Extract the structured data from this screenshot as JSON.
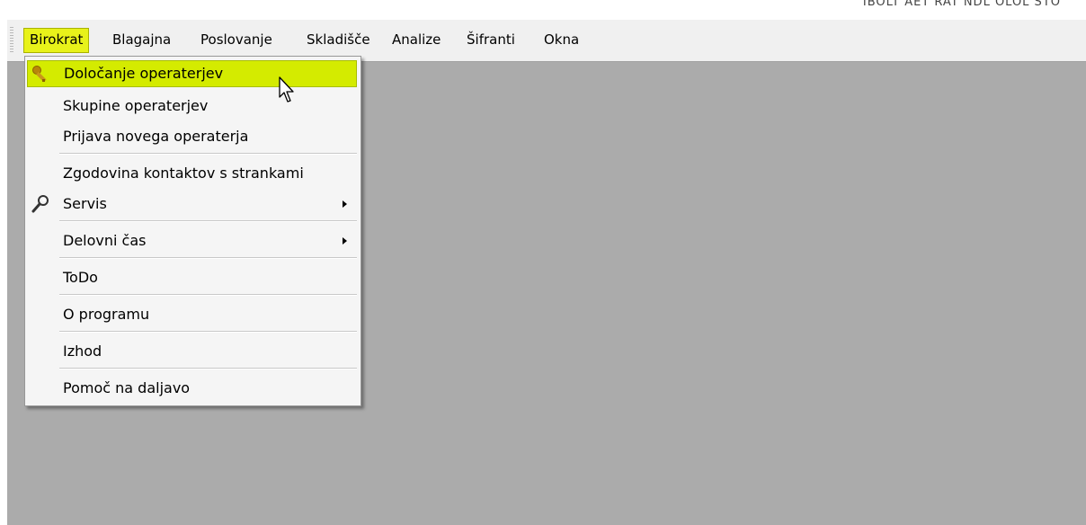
{
  "window": {
    "title_fragment": "IBOLT AET RAT NDL OLOL STO"
  },
  "menubar": {
    "items": [
      {
        "label": "Birokrat",
        "active": true
      },
      {
        "label": "Blagajna"
      },
      {
        "label": "Poslovanje"
      },
      {
        "label": "Skladišče"
      },
      {
        "label": "Analize"
      },
      {
        "label": "Šifranti"
      },
      {
        "label": "Okna"
      }
    ]
  },
  "dropdown": {
    "items": [
      {
        "label": "Določanje operaterjev",
        "icon": "key-icon",
        "highlighted": true
      },
      {
        "label": "Skupine operaterjev"
      },
      {
        "label": "Prijava novega operaterja"
      },
      {
        "label": "Zgodovina kontaktov s strankami"
      },
      {
        "label": "Servis",
        "icon": "wrench-icon",
        "submenu": true
      },
      {
        "label": "Delovni čas",
        "submenu": true
      },
      {
        "label": "ToDo"
      },
      {
        "label": "O programu"
      },
      {
        "label": "Izhod"
      },
      {
        "label": "Pomoč na daljavo"
      }
    ]
  },
  "colors": {
    "highlight": "#d4eb00",
    "workspace": "#ababab",
    "menubar": "#f0f0f0"
  }
}
